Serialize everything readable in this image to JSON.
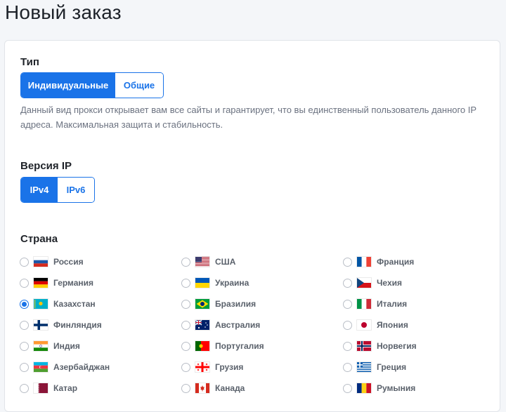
{
  "page": {
    "title": "Новый заказ"
  },
  "type_section": {
    "label": "Тип",
    "options": [
      "Индивидуальные",
      "Общие"
    ],
    "selected": "Индивидуальные",
    "description": "Данный вид прокси открывает вам все сайты и гарантирует, что вы единственный пользователь данного IP адреса. Максимальная защита и стабильность."
  },
  "ip_section": {
    "label": "Версия IP",
    "options": [
      "IPv4",
      "IPv6"
    ],
    "selected": "IPv4"
  },
  "country_section": {
    "label": "Страна",
    "selected": "Казахстан",
    "countries": [
      {
        "name": "Россия",
        "flag": "russia-flag"
      },
      {
        "name": "США",
        "flag": "usa-flag"
      },
      {
        "name": "Франция",
        "flag": "france-flag"
      },
      {
        "name": "Германия",
        "flag": "germany-flag"
      },
      {
        "name": "Украина",
        "flag": "ukraine-flag"
      },
      {
        "name": "Чехия",
        "flag": "czech-flag"
      },
      {
        "name": "Казахстан",
        "flag": "kazakhstan-flag"
      },
      {
        "name": "Бразилия",
        "flag": "brazil-flag"
      },
      {
        "name": "Италия",
        "flag": "italy-flag"
      },
      {
        "name": "Финляндия",
        "flag": "finland-flag"
      },
      {
        "name": "Австралия",
        "flag": "australia-flag"
      },
      {
        "name": "Япония",
        "flag": "japan-flag"
      },
      {
        "name": "Индия",
        "flag": "india-flag"
      },
      {
        "name": "Португалия",
        "flag": "portugal-flag"
      },
      {
        "name": "Норвегия",
        "flag": "norway-flag"
      },
      {
        "name": "Азербайджан",
        "flag": "azerbaijan-flag"
      },
      {
        "name": "Грузия",
        "flag": "georgia-flag"
      },
      {
        "name": "Греция",
        "flag": "greece-flag"
      },
      {
        "name": "Катар",
        "flag": "qatar-flag"
      },
      {
        "name": "Канада",
        "flag": "canada-flag"
      },
      {
        "name": "Румыния",
        "flag": "romania-flag"
      }
    ]
  },
  "colors": {
    "accent": "#1a73e8",
    "muted_text": "#6b7280",
    "country_text": "#5a616b"
  }
}
